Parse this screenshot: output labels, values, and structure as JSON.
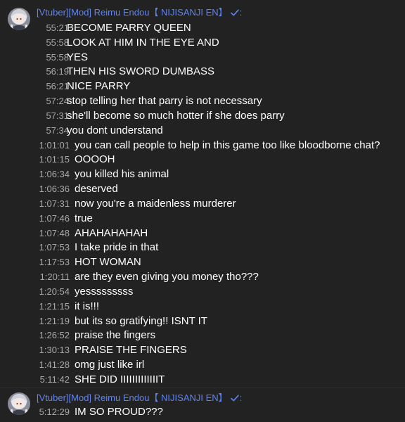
{
  "groups": [
    {
      "author": "[Vtuber][Mod] Reimu Endou【 NIJISANJI EN】",
      "verified_icon": "checkmark-icon",
      "colon": ":",
      "messages": [
        {
          "time": "55:21",
          "text": "BECOME PARRY QUEEN"
        },
        {
          "time": "55:58",
          "text": "LOOK AT HIM IN THE EYE AND"
        },
        {
          "time": "55:58",
          "text": "YES"
        },
        {
          "time": "56:19",
          "text": "THEN HIS SWORD DUMBASS"
        },
        {
          "time": "56:21",
          "text": "NICE PARRY"
        },
        {
          "time": "57:24",
          "text": "stop telling her that parry is not necessary"
        },
        {
          "time": "57:31",
          "text": "she'll become so much hotter if she does parry"
        },
        {
          "time": "57:34",
          "text": "you dont understand"
        },
        {
          "time": "1:01:01",
          "text": "you can call people to help in this game too like bloodborne chat?"
        },
        {
          "time": "1:01:15",
          "text": "OOOOH"
        },
        {
          "time": "1:06:34",
          "text": "you killed his animal"
        },
        {
          "time": "1:06:36",
          "text": "deserved"
        },
        {
          "time": "1:07:31",
          "text": "now you're a maidenless murderer"
        },
        {
          "time": "1:07:46",
          "text": "true"
        },
        {
          "time": "1:07:48",
          "text": "AHAHAHAHAH"
        },
        {
          "time": "1:07:53",
          "text": "I take pride in that"
        },
        {
          "time": "1:17:53",
          "text": "HOT WOMAN"
        },
        {
          "time": "1:20:11",
          "text": "are they even giving you money tho???"
        },
        {
          "time": "1:20:54",
          "text": "yesssssssss"
        },
        {
          "time": "1:21:15",
          "text": "it is!!!"
        },
        {
          "time": "1:21:19",
          "text": "but its so gratifying!! ISNT IT"
        },
        {
          "time": "1:26:52",
          "text": "praise the fingers"
        },
        {
          "time": "1:30:13",
          "text": "PRAISE THE FINGERS"
        },
        {
          "time": "1:41:28",
          "text": "omg just like irl"
        },
        {
          "time": "5:11:42",
          "text": "SHE DID IIIIIIIIIIIIIT"
        }
      ]
    },
    {
      "author": "[Vtuber][Mod] Reimu Endou【 NIJISANJI EN】",
      "verified_icon": "checkmark-icon",
      "colon": ":",
      "messages": [
        {
          "time": "5:12:29",
          "text": "IM SO PROUD???"
        }
      ]
    }
  ],
  "colors": {
    "background": "#222222",
    "author": "#5e84f1",
    "timestamp": "#aaaaaa",
    "message": "#ffffff"
  }
}
